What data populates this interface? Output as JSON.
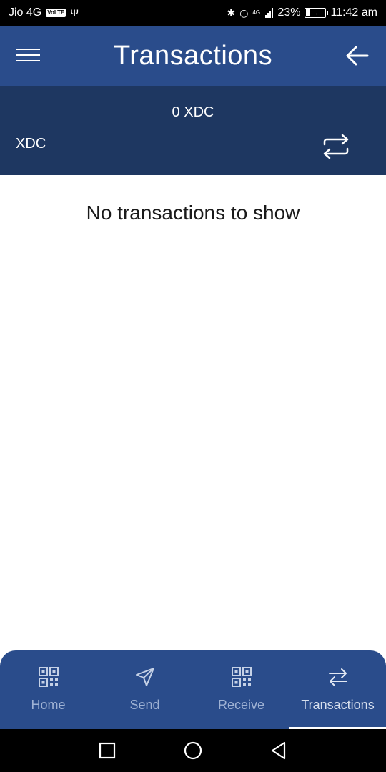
{
  "status_bar": {
    "carrier": "Jio 4G",
    "volte": "VoLTE",
    "network_badge": "4G",
    "battery_percent": "23%",
    "time": "11:42 am"
  },
  "app_bar": {
    "title": "Transactions"
  },
  "balance": {
    "amount": "0 XDC",
    "currency": "XDC"
  },
  "main": {
    "empty_message": "No transactions to show"
  },
  "bottom_nav": {
    "items": [
      {
        "label": "Home",
        "icon": "qr-code-icon"
      },
      {
        "label": "Send",
        "icon": "send-icon"
      },
      {
        "label": "Receive",
        "icon": "qr-code-icon"
      },
      {
        "label": "Transactions",
        "icon": "transfer-arrows-icon"
      }
    ],
    "active_index": 3
  },
  "colors": {
    "app_bar": "#2a4c8b",
    "balance_panel": "#1e3761",
    "nav_inactive": "#9fb2d4"
  }
}
